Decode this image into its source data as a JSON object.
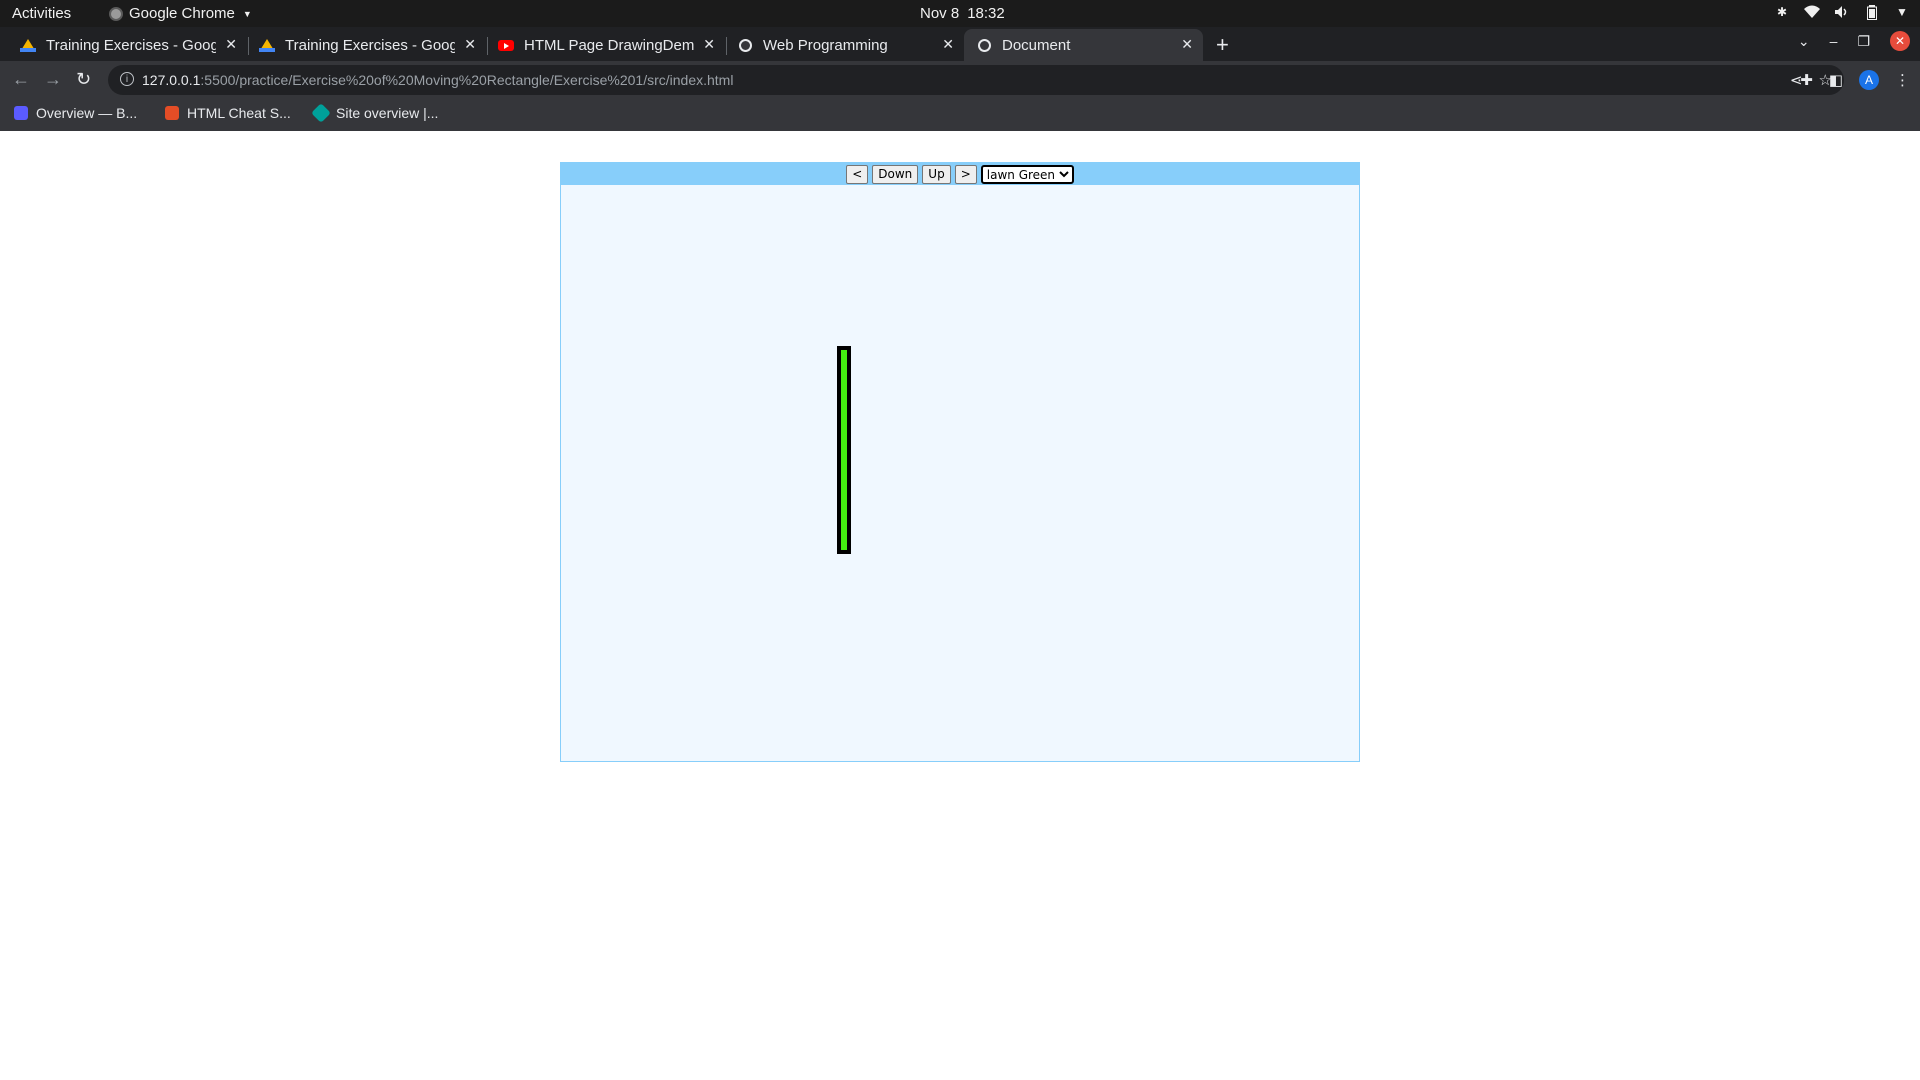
{
  "topbar": {
    "activities": "Activities",
    "app_name": "Google Chrome",
    "date": "Nov 8",
    "time": "18:32"
  },
  "tabs": [
    {
      "title": "Training Exercises - Google Drive",
      "favicon": "google-drive-icon",
      "active": false
    },
    {
      "title": "Training Exercises - Google Drive",
      "favicon": "google-drive-icon",
      "active": false
    },
    {
      "title": "HTML Page DrawingDemo",
      "favicon": "youtube-icon",
      "active": false
    },
    {
      "title": "Web Programming",
      "favicon": "globe-icon",
      "active": false
    },
    {
      "title": "Document",
      "favicon": "globe-icon",
      "active": true
    }
  ],
  "omnibox": {
    "host": "127.0.0.1",
    "path": ":5500/practice/Exercise%20of%20Moving%20Rectangle/Exercise%201/src/index.html"
  },
  "bookmarks": [
    {
      "label": "Overview — B...",
      "color": "#5b5bff"
    },
    {
      "label": "HTML Cheat S...",
      "color": "#e44d26"
    },
    {
      "label": "Site overview |...",
      "color": "#00a19a"
    }
  ],
  "app": {
    "buttons": {
      "left": "<",
      "down": "Down",
      "up": "Up",
      "right": ">"
    },
    "color_select": {
      "selected": "lawn Green"
    },
    "rectangle": {
      "fill_color": "#44ee11",
      "border_color": "#000000"
    },
    "stage_background": "#f0f8ff",
    "controls_background": "#87cefa"
  }
}
